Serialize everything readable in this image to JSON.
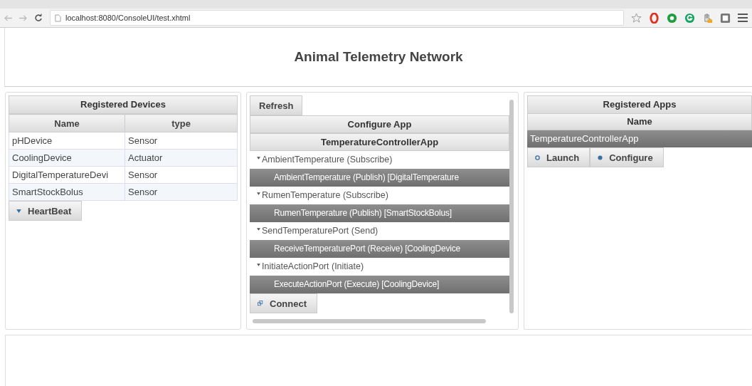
{
  "browser": {
    "url": "localhost:8080/ConsoleUI/test.xhtml"
  },
  "header": {
    "title": "Animal Telemetry Network"
  },
  "devices": {
    "title": "Registered Devices",
    "columns": [
      "Name",
      "type"
    ],
    "rows": [
      {
        "name": "pHDevice",
        "type": "Sensor"
      },
      {
        "name": "CoolingDevice",
        "type": "Actuator"
      },
      {
        "name": "DigitalTemperatureDevi",
        "type": "Sensor"
      },
      {
        "name": "SmartStockBolus",
        "type": "Sensor"
      }
    ],
    "button": "HeartBeat"
  },
  "configure": {
    "refresh": "Refresh",
    "title": "Configure App",
    "app": "TemperatureControllerApp",
    "items": [
      {
        "label": "AmbientTemperature (Subscribe)",
        "kind": "port",
        "selected": false
      },
      {
        "label": "AmbientTemperature (Publish) [DigitalTemperature",
        "kind": "match",
        "selected": true
      },
      {
        "label": "RumenTemperature (Subscribe)",
        "kind": "port",
        "selected": false
      },
      {
        "label": "RumenTemperature (Publish) [SmartStockBolus]",
        "kind": "match",
        "selected": true
      },
      {
        "label": "SendTemperaturePort (Send)",
        "kind": "port",
        "selected": false
      },
      {
        "label": "ReceiveTemperaturePort (Receive) [CoolingDevice",
        "kind": "match",
        "selected": true
      },
      {
        "label": "InitiateActionPort (Initiate)",
        "kind": "port",
        "selected": false
      },
      {
        "label": "ExecuteActionPort (Execute) [CoolingDevice]",
        "kind": "match",
        "selected": true
      }
    ],
    "connect": "Connect"
  },
  "apps": {
    "title": "Registered Apps",
    "column": "Name",
    "rows": [
      {
        "name": "TemperatureControllerApp",
        "selected": true
      }
    ],
    "buttons": [
      "Launch",
      "Configure"
    ]
  }
}
